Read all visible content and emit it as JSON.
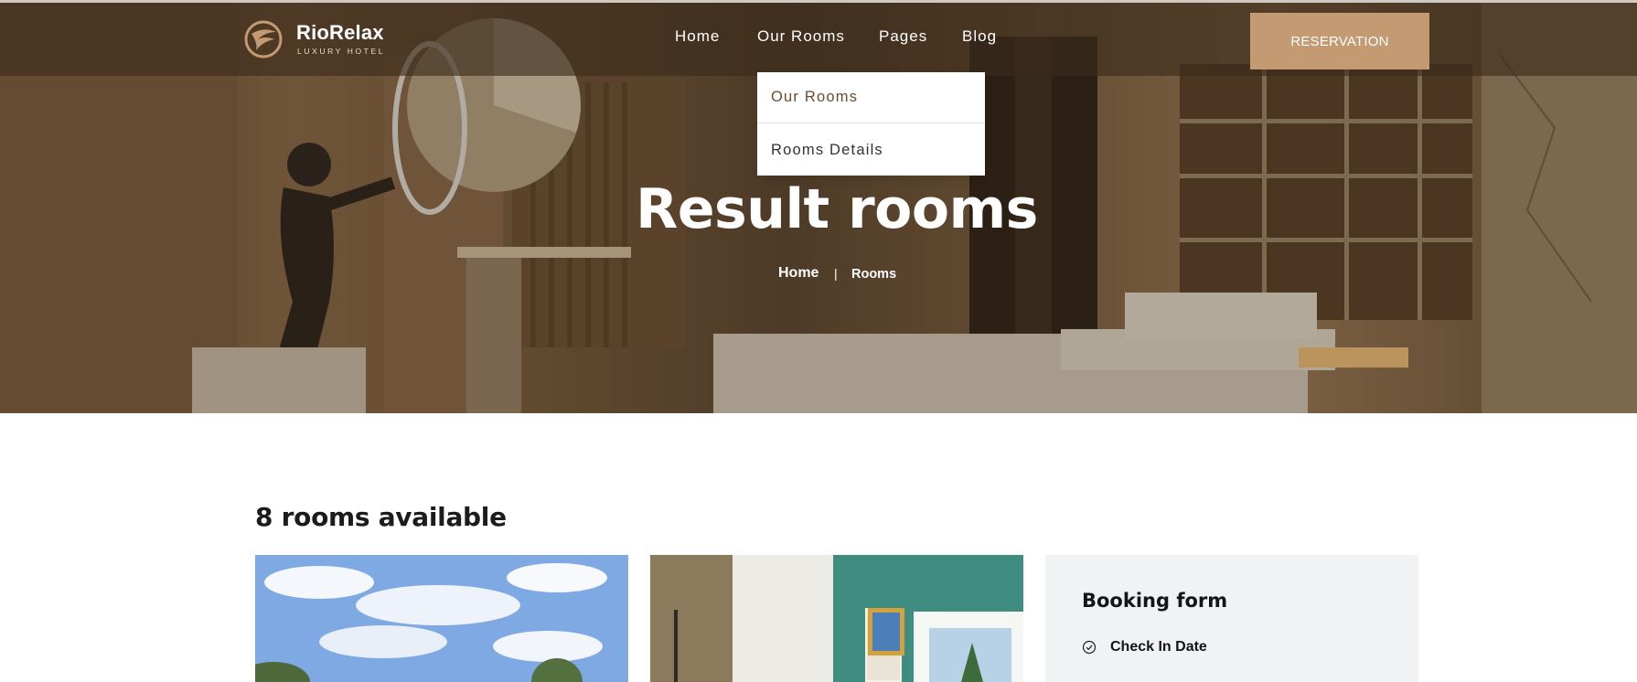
{
  "brand": {
    "name": "RioRelax",
    "tagline": "LUXURY HOTEL",
    "accent_color": "#c49a72"
  },
  "nav": {
    "items": [
      {
        "label": "Home"
      },
      {
        "label": "Our Rooms"
      },
      {
        "label": "Pages"
      },
      {
        "label": "Blog"
      }
    ],
    "cta_label": "RESERVATION",
    "dropdown": {
      "items": [
        {
          "label": "Our Rooms"
        },
        {
          "label": "Rooms Details"
        }
      ]
    }
  },
  "hero": {
    "title": "Result rooms",
    "breadcrumb": {
      "home": "Home",
      "separator": "|",
      "current": "Rooms"
    }
  },
  "content": {
    "heading": "8 rooms available",
    "booking": {
      "title": "Booking form",
      "field_label": "Check In Date",
      "field_icon": "check-circle-icon"
    }
  }
}
